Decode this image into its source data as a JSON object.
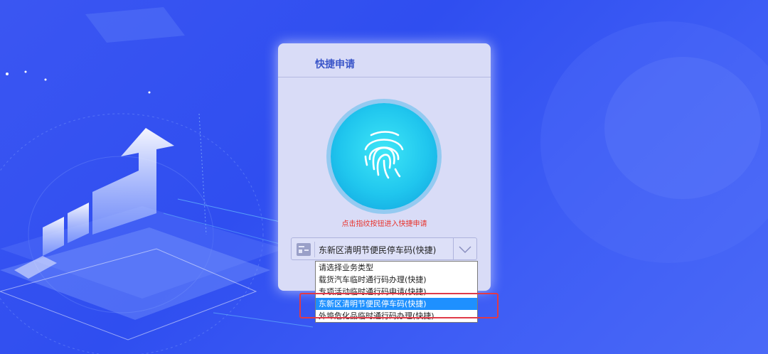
{
  "panel": {
    "title": "快捷申请",
    "hint": "点击指纹按钮进入快捷申请"
  },
  "select": {
    "value": "东新区清明节便民停车码(快捷)"
  },
  "dropdown": {
    "options": [
      "请选择业务类型",
      "载货汽车临时通行码办理(快捷)",
      "专项活动临时通行码申请(快捷)",
      "东新区清明节便民停车码(快捷)",
      "外埠危化品临时通行码办理(快捷)"
    ],
    "selected_index": 3
  },
  "colors": {
    "background": "#3b56f2",
    "panel": "#d9dcf7",
    "title": "#3b56c9",
    "hint": "#e8332c",
    "selected_option": "#1e90ff",
    "annotation_box": "#e03a48"
  },
  "icons": {
    "main": "fingerprint-icon",
    "select_leading": "card-icon",
    "select_trailing": "chevron-down-icon"
  }
}
